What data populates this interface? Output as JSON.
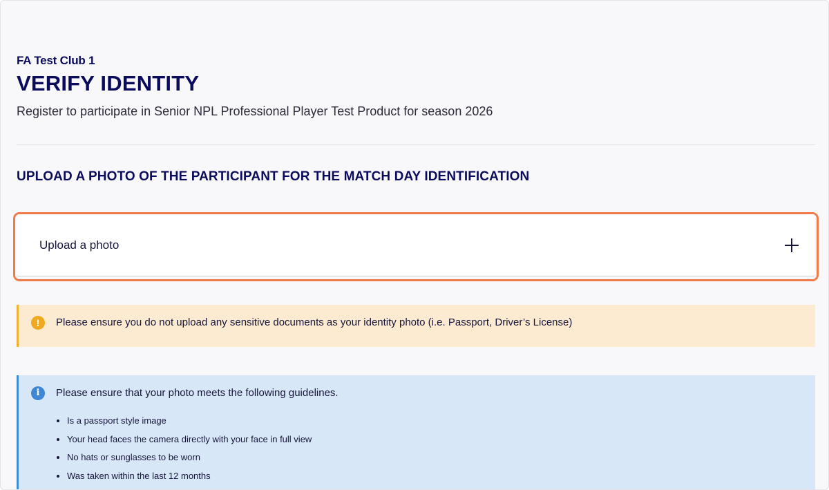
{
  "header": {
    "club_name": "FA Test Club 1",
    "title": "VERIFY IDENTITY",
    "subtitle": "Register to participate in Senior NPL Professional Player Test Product for season 2026"
  },
  "section": {
    "heading": "UPLOAD A PHOTO OF THE PARTICIPANT FOR THE MATCH DAY IDENTIFICATION"
  },
  "upload": {
    "label": "Upload a photo",
    "icon": "plus-icon"
  },
  "warning": {
    "icon": "exclamation-circle-icon",
    "icon_glyph": "!",
    "text": "Please ensure you do not upload any sensitive documents as your identity photo (i.e. Passport, Driver’s License)",
    "color": "#efaa1f"
  },
  "info": {
    "icon": "info-circle-icon",
    "icon_glyph": "i",
    "text": "Please ensure that your photo meets the following guidelines.",
    "color": "#3f86d6",
    "guidelines": [
      "Is a passport style image",
      "Your head faces the camera directly with your face in full view",
      "No hats or sunglasses to be worn",
      "Was taken within the last 12 months"
    ]
  },
  "colors": {
    "brand_navy": "#0b0b5c",
    "focus_outline": "#f07a4a"
  }
}
